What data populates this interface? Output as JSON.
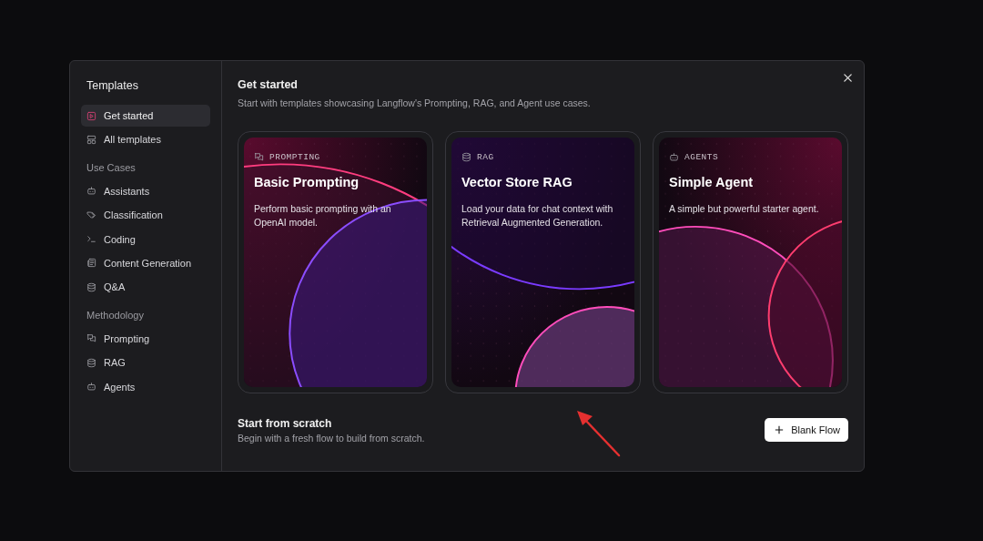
{
  "sidebar": {
    "title": "Templates",
    "groups": [
      {
        "items": [
          {
            "label": "Get started",
            "selected": true
          },
          {
            "label": "All templates",
            "selected": false
          }
        ]
      },
      {
        "heading": "Use Cases",
        "items": [
          {
            "label": "Assistants",
            "selected": false
          },
          {
            "label": "Classification",
            "selected": false
          },
          {
            "label": "Coding",
            "selected": false
          },
          {
            "label": "Content Generation",
            "selected": false
          },
          {
            "label": "Q&A",
            "selected": false
          }
        ]
      },
      {
        "heading": "Methodology",
        "items": [
          {
            "label": "Prompting",
            "selected": false
          },
          {
            "label": "RAG",
            "selected": false
          },
          {
            "label": "Agents",
            "selected": false
          }
        ]
      }
    ]
  },
  "main": {
    "title": "Get started",
    "subtitle": "Start with templates showcasing Langflow's Prompting, RAG, and Agent use cases.",
    "cards": [
      {
        "tag": "PROMPTING",
        "title": "Basic Prompting",
        "description": "Perform basic prompting with an OpenAI model."
      },
      {
        "tag": "RAG",
        "title": "Vector Store RAG",
        "description": "Load your data for chat context with Retrieval Augmented Generation."
      },
      {
        "tag": "AGENTS",
        "title": "Simple Agent",
        "description": "A simple but powerful starter agent."
      }
    ],
    "scratch": {
      "title": "Start from scratch",
      "description": "Begin with a fresh flow to build from scratch.",
      "button": "Blank Flow"
    }
  }
}
